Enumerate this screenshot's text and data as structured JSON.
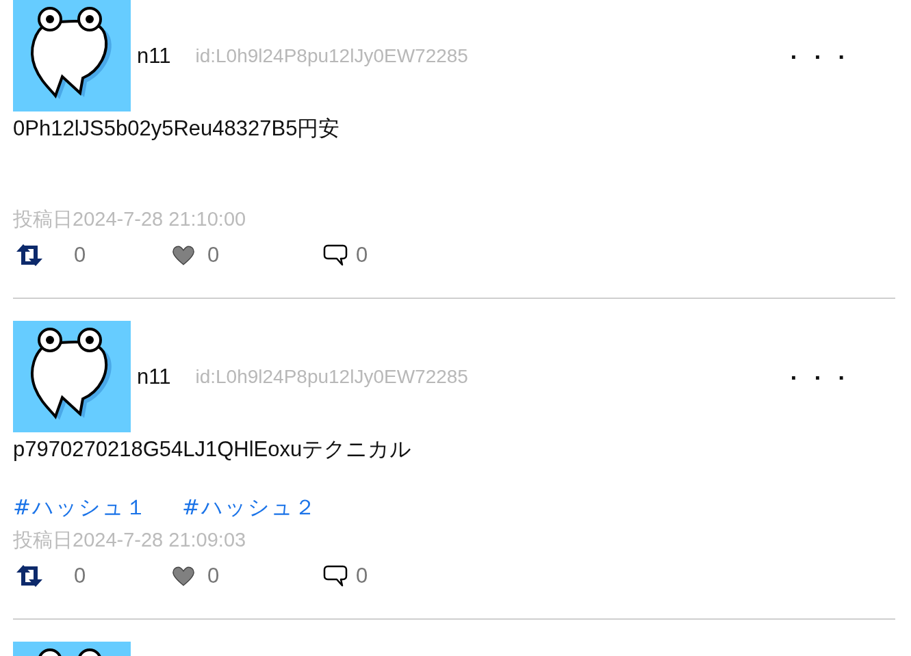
{
  "posts": [
    {
      "name": "n11",
      "user_id": "id:L0h9l24P8pu12lJy0EW72285",
      "menu": ". . .",
      "content": "0Ph12lJS5b02y5Reu48327B5円安",
      "date": "投稿日2024-7-28 21:10:00",
      "reposts": "0",
      "likes": "0",
      "comments": "0"
    },
    {
      "name": "n11",
      "user_id": "id:L0h9l24P8pu12lJy0EW72285",
      "menu": ". . .",
      "content": "p7970270218G54LJ1QHlEoxuテクニカル",
      "hashtags": [
        "#ハッシュ１",
        "#ハッシュ２"
      ],
      "date": "投稿日2024-7-28 21:09:03",
      "reposts": "0",
      "likes": "0",
      "comments": "0"
    }
  ]
}
